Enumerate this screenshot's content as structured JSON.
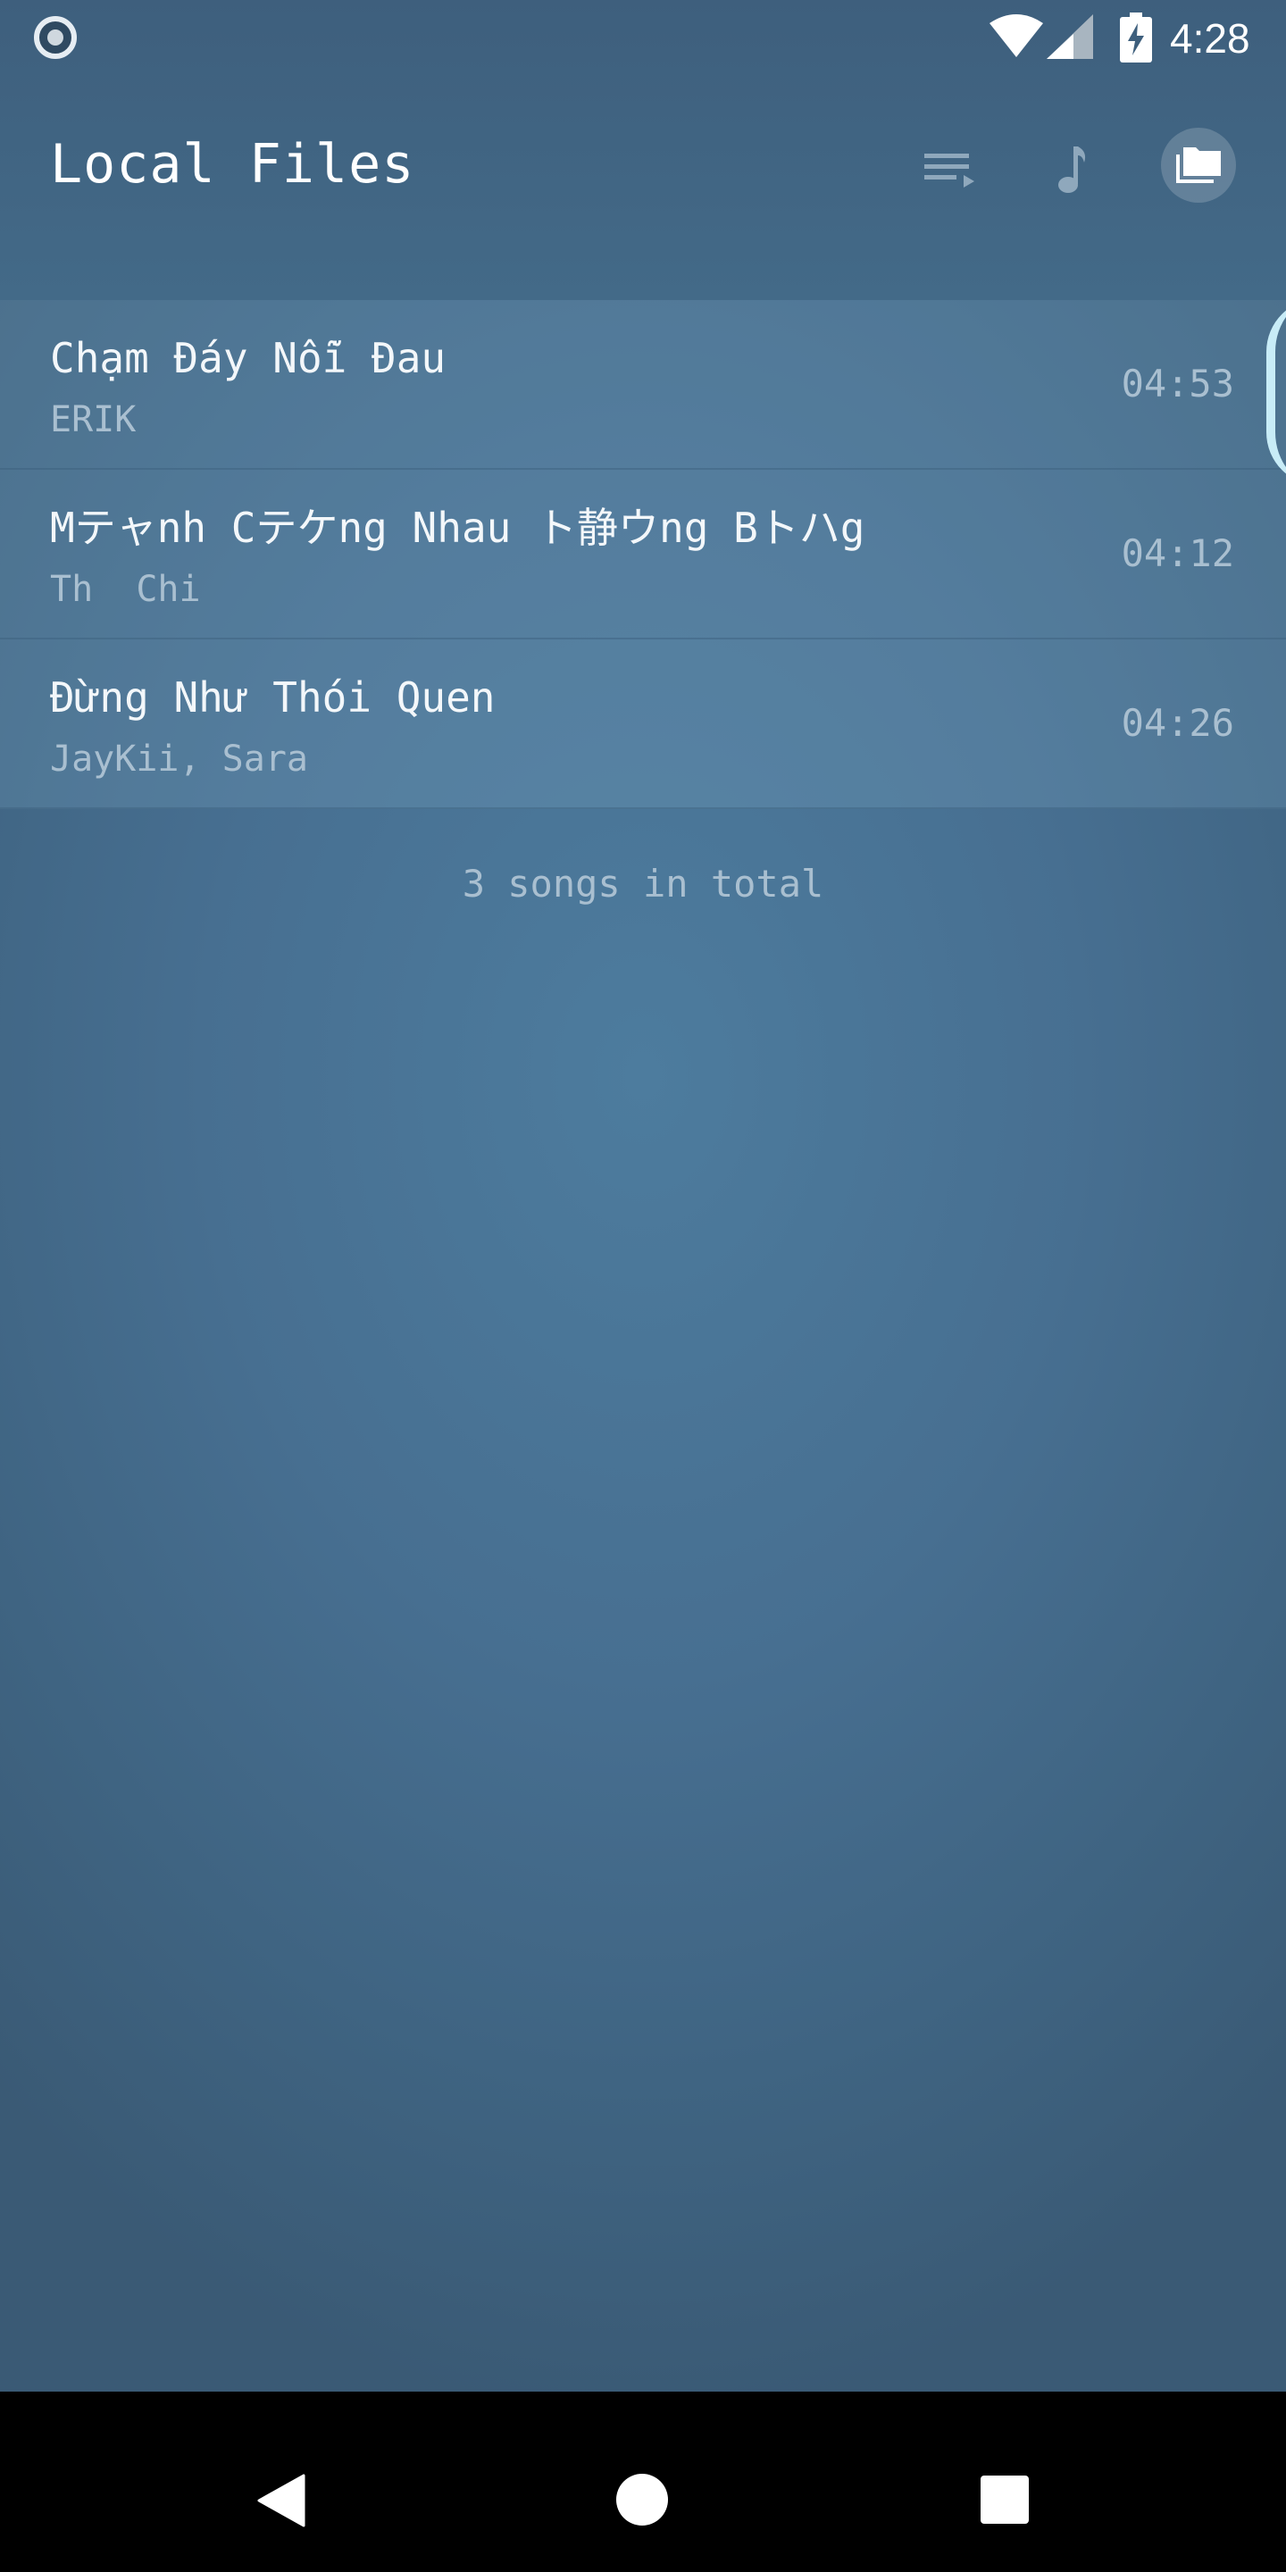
{
  "status_bar": {
    "time": "4:28",
    "icons": [
      "app-notification-icon",
      "wifi-icon",
      "signal-icon",
      "battery-charging-icon"
    ]
  },
  "header": {
    "title": "Local Files",
    "actions": [
      "queue-icon",
      "music-note-icon",
      "folder-icon"
    ]
  },
  "songs": [
    {
      "title": "Chạm Đáy Nỗi Đau",
      "artist": "ERIK",
      "duration": "04:53"
    },
    {
      "title": "Mテャnh Cテケng Nhau ト静ウng Bトハg",
      "artist": "Th  Chi",
      "duration": "04:12"
    },
    {
      "title": "Đừng Như Thói Quen",
      "artist": "JayKii, Sara",
      "duration": "04:26"
    }
  ],
  "footer": {
    "count_text": "3 songs in total"
  },
  "nav_bar": {
    "icons": [
      "back-icon",
      "home-icon",
      "recents-icon"
    ]
  },
  "colors": {
    "background": "#476f91",
    "row_background": "#5a819f",
    "secondary_text": "#a9bfd0",
    "scroll_indicator": "#c8ecf7"
  }
}
